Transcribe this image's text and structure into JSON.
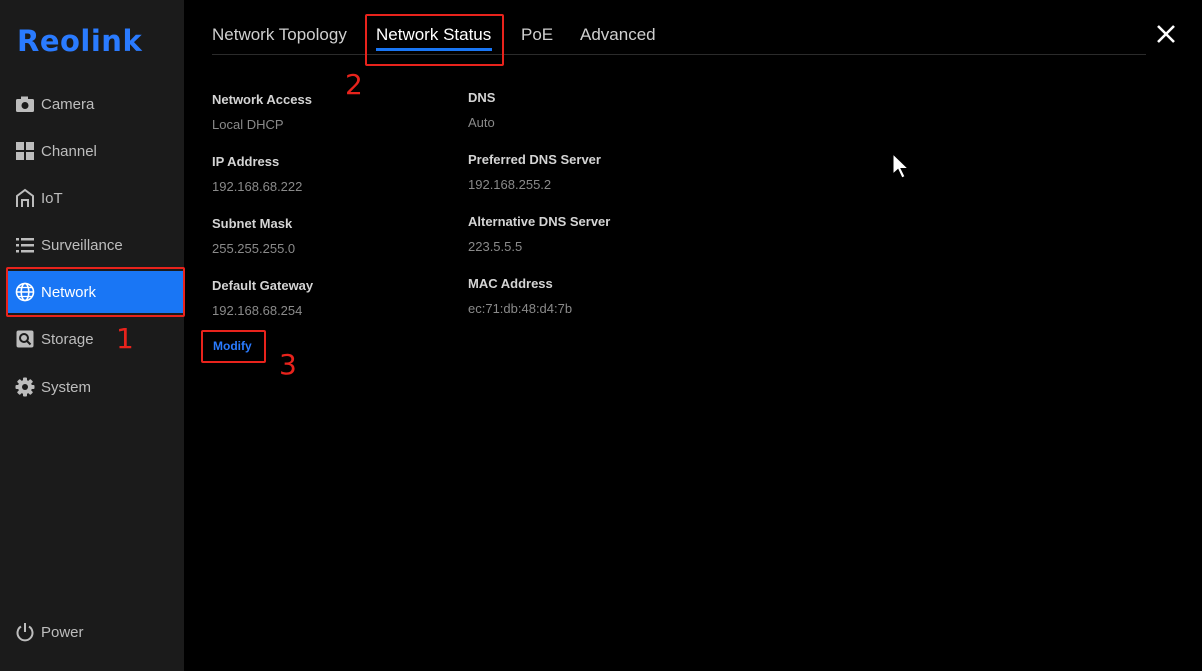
{
  "brand": {
    "logo_text": "Reolink",
    "accent": "#1976f5",
    "annotation_color": "#e8231c"
  },
  "sidebar": {
    "items": [
      {
        "label": "Camera",
        "icon": "camera-icon"
      },
      {
        "label": "Channel",
        "icon": "grid-icon"
      },
      {
        "label": "IoT",
        "icon": "home-icon"
      },
      {
        "label": "Surveillance",
        "icon": "list-icon"
      },
      {
        "label": "Network",
        "icon": "globe-icon",
        "active": true
      },
      {
        "label": "Storage",
        "icon": "storage-icon"
      },
      {
        "label": "System",
        "icon": "gear-icon"
      }
    ],
    "power_label": "Power"
  },
  "tabs": [
    {
      "label": "Network Topology"
    },
    {
      "label": "Network Status",
      "active": true
    },
    {
      "label": "PoE"
    },
    {
      "label": "Advanced"
    }
  ],
  "status": {
    "left": [
      {
        "label": "Network Access",
        "value": "Local DHCP"
      },
      {
        "label": "IP Address",
        "value": "192.168.68.222"
      },
      {
        "label": "Subnet Mask",
        "value": "255.255.255.0"
      },
      {
        "label": "Default Gateway",
        "value": "192.168.68.254"
      }
    ],
    "right": [
      {
        "label": "DNS",
        "value": "Auto"
      },
      {
        "label": "Preferred DNS Server",
        "value": "192.168.255.2"
      },
      {
        "label": "Alternative DNS Server",
        "value": "223.5.5.5"
      },
      {
        "label": "MAC Address",
        "value": "ec:71:db:48:d4:7b"
      }
    ],
    "modify_label": "Modify"
  },
  "annotations": {
    "one": "1",
    "two": "2",
    "three": "3"
  }
}
